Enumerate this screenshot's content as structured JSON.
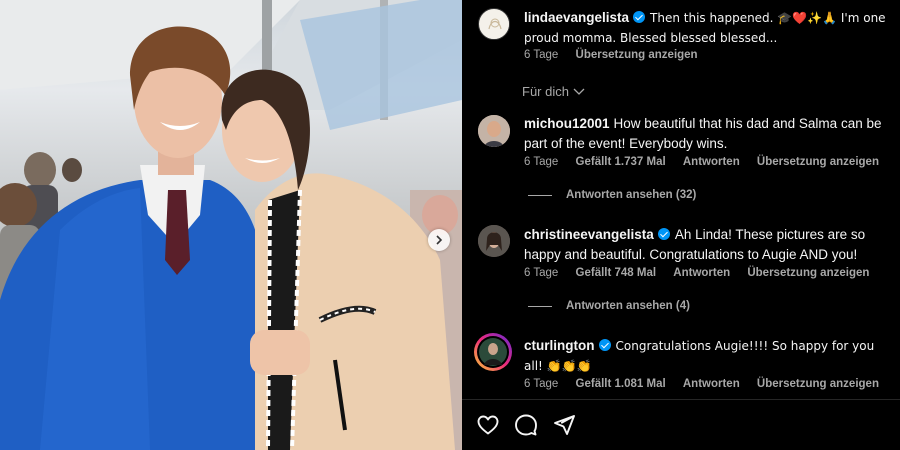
{
  "caption": {
    "username": "lindaevangelista",
    "text": "Then this happened. 🎓❤️✨🙏 I'm one proud momma. Blessed blessed blessed...",
    "age": "6 Tage",
    "translate": "Übersetzung anzeigen"
  },
  "sort_label": "Für dich",
  "comments": [
    {
      "username": "michou12001",
      "text": "How beautiful that his dad and Salma can be part of the event! Everybody wins.",
      "age": "6 Tage",
      "likes": "Gefällt 1.737 Mal",
      "reply": "Antworten",
      "translate": "Übersetzung anzeigen",
      "view_replies": "Antworten ansehen (32)"
    },
    {
      "username": "christineevangelista",
      "text": "Ah Linda! These pictures are so happy and beautiful. Congratulations to Augie AND you!",
      "age": "6 Tage",
      "likes": "Gefällt 748 Mal",
      "reply": "Antworten",
      "translate": "Übersetzung anzeigen",
      "view_replies": "Antworten ansehen (4)"
    },
    {
      "username": "cturlington",
      "text": "Congratulations Augie!!!! So happy for you all! 👏👏👏",
      "age": "6 Tage",
      "likes": "Gefällt 1.081 Mal",
      "reply": "Antworten",
      "translate": "Übersetzung anzeigen"
    }
  ],
  "colors": {
    "background": "#000000",
    "text": "#f5f5f5",
    "secondary": "#a8a8a8",
    "verified": "#0095f6",
    "gown_blue": "#1f5fc4"
  },
  "icons": [
    "heart-icon",
    "comment-icon",
    "share-icon",
    "chevron-down-icon",
    "chevron-right-icon",
    "verified-badge-icon"
  ]
}
